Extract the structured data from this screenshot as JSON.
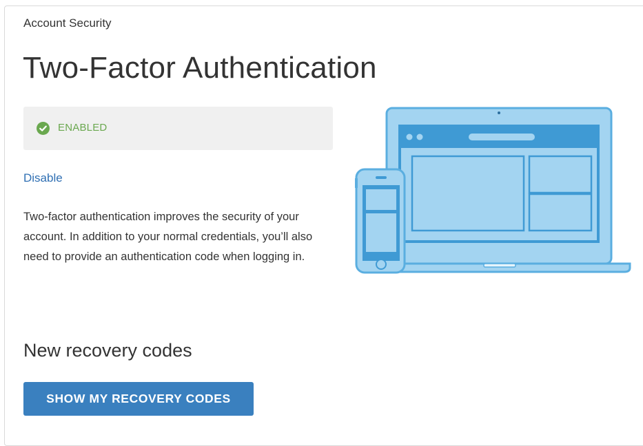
{
  "breadcrumb": "Account Security",
  "title": "Two-Factor Authentication",
  "status": {
    "label": "ENABLED",
    "icon": "check-circle-icon",
    "color": "#6aa84f"
  },
  "disable_link": "Disable",
  "description": "Two-factor authentication improves the security of your account. In addition to your normal credentials, you’ll also need to provide an authentication code when logging in.",
  "recovery": {
    "heading": "New recovery codes",
    "button_label": "SHOW MY RECOVERY CODES"
  },
  "illustration": {
    "icon": "laptop-and-phone-illustration",
    "colors": {
      "outline": "#5aaee0",
      "fill": "#a3d4f1",
      "dark": "#3f9ad4"
    }
  },
  "colors": {
    "accent": "#3a80bf",
    "link": "#2f6fb3",
    "text": "#333333"
  }
}
